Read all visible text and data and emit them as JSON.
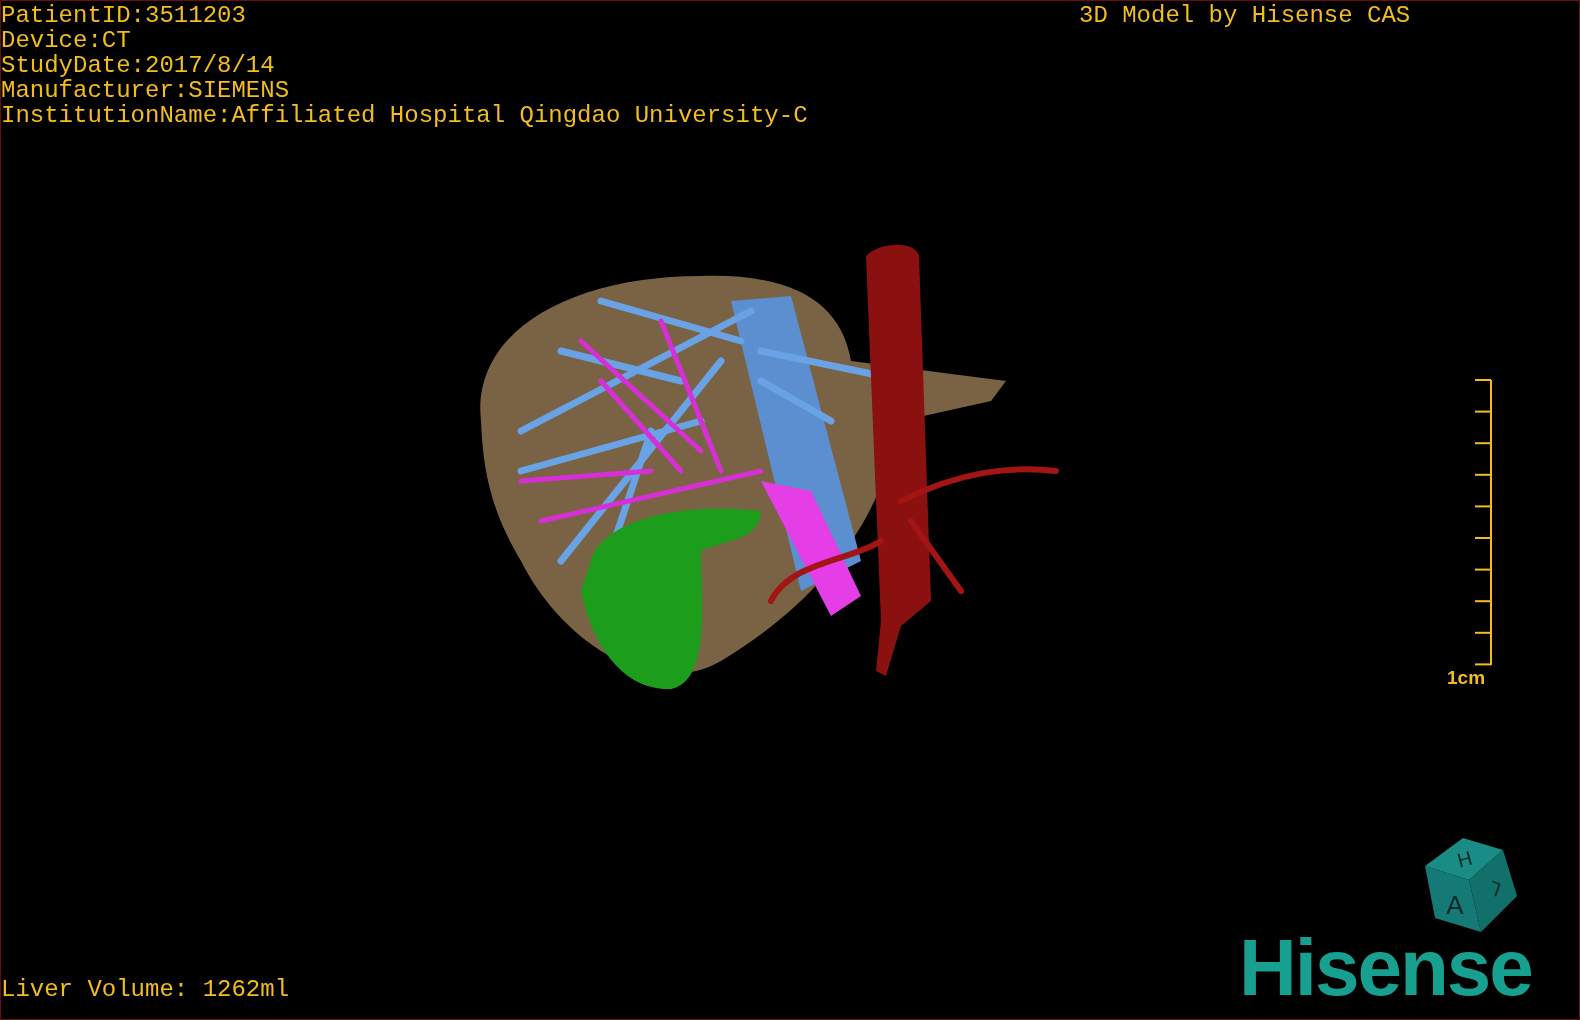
{
  "info_lines": [
    "PatientID:3511203",
    "Device:CT",
    "StudyDate:2017/8/14",
    "Manufacturer:SIEMENS",
    "InstitutionName:Affiliated Hospital Qingdao University-C"
  ],
  "title": "3D Model by Hisense CAS",
  "scale_bar": {
    "label": "1cm"
  },
  "orientation_cube": {
    "top": "H",
    "front": "A",
    "side": "L"
  },
  "logo": "Hisense",
  "volume": "Liver Volume: 1262ml"
}
